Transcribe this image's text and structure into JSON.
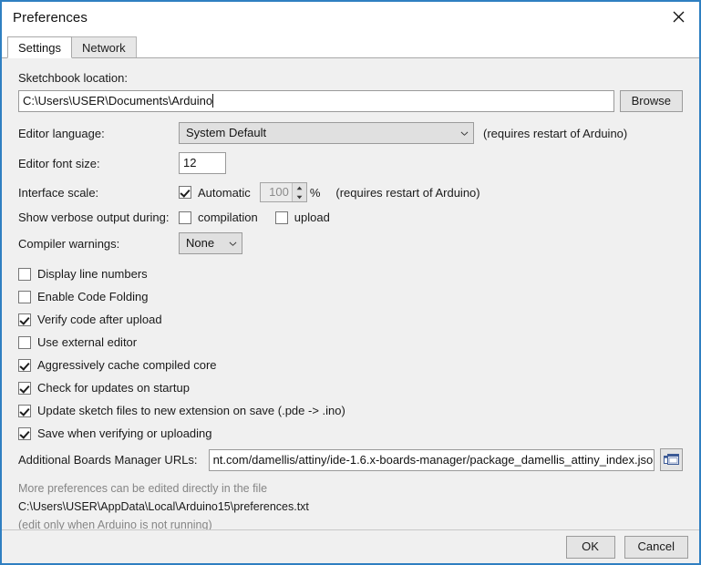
{
  "window": {
    "title": "Preferences",
    "close_icon": "close-icon",
    "accent_border": "#2f7fc1"
  },
  "tabs": [
    {
      "label": "Settings",
      "active": true
    },
    {
      "label": "Network",
      "active": false
    }
  ],
  "settings": {
    "sketchbook": {
      "label": "Sketchbook location:",
      "value": "C:\\Users\\USER\\Documents\\Arduino",
      "browse_label": "Browse"
    },
    "editor_language": {
      "label": "Editor language:",
      "value": "System Default",
      "hint": "(requires restart of Arduino)"
    },
    "editor_font_size": {
      "label": "Editor font size:",
      "value": "12"
    },
    "interface_scale": {
      "label": "Interface scale:",
      "automatic_label": "Automatic",
      "automatic_checked": true,
      "scale_value": "100",
      "percent_label": "%",
      "hint": "(requires restart of Arduino)"
    },
    "verbose_output": {
      "label": "Show verbose output during:",
      "compilation_label": "compilation",
      "compilation_checked": false,
      "upload_label": "upload",
      "upload_checked": false
    },
    "compiler_warnings": {
      "label": "Compiler warnings:",
      "value": "None"
    },
    "checkboxes": [
      {
        "label": "Display line numbers",
        "checked": false
      },
      {
        "label": "Enable Code Folding",
        "checked": false
      },
      {
        "label": "Verify code after upload",
        "checked": true
      },
      {
        "label": "Use external editor",
        "checked": false
      },
      {
        "label": "Aggressively cache compiled core",
        "checked": true
      },
      {
        "label": "Check for updates on startup",
        "checked": true
      },
      {
        "label": "Update sketch files to new extension on save (.pde -> .ino)",
        "checked": true
      },
      {
        "label": "Save when verifying or uploading",
        "checked": true
      }
    ],
    "boards_urls": {
      "label": "Additional Boards Manager URLs:",
      "value": "nt.com/damellis/attiny/ide-1.6.x-boards-manager/package_damellis_attiny_index.json",
      "expand_icon": "open-window-icon"
    },
    "footer_notes": {
      "line1": "More preferences can be edited directly in the file",
      "line2": "C:\\Users\\USER\\AppData\\Local\\Arduino15\\preferences.txt",
      "line3": "(edit only when Arduino is not running)"
    }
  },
  "buttons": {
    "ok": "OK",
    "cancel": "Cancel"
  }
}
